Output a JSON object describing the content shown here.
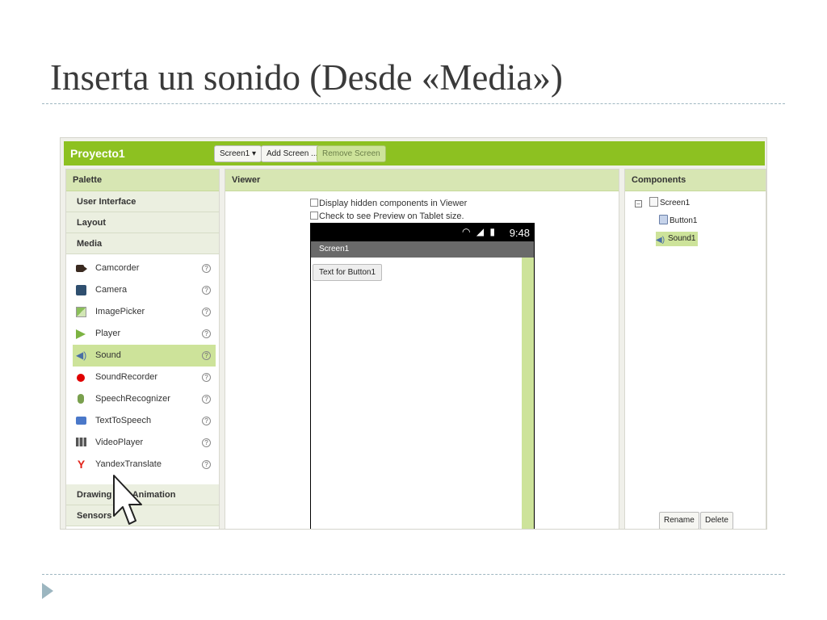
{
  "slide": {
    "title": "Inserta un sonido (Desde «Media»)"
  },
  "app": {
    "project_title": "Proyecto1",
    "toolbar": {
      "screen_selector": "Screen1 ▾",
      "add_screen": "Add Screen ...",
      "remove_screen": "Remove Screen"
    }
  },
  "palette": {
    "header": "Palette",
    "categories_top": [
      "User Interface",
      "Layout",
      "Media"
    ],
    "media_items": [
      {
        "label": "Camcorder",
        "icon": "camcorder-icon"
      },
      {
        "label": "Camera",
        "icon": "camera-icon"
      },
      {
        "label": "ImagePicker",
        "icon": "imagepicker-icon"
      },
      {
        "label": "Player",
        "icon": "player-icon"
      },
      {
        "label": "Sound",
        "icon": "sound-icon",
        "selected": true
      },
      {
        "label": "SoundRecorder",
        "icon": "soundrecorder-icon"
      },
      {
        "label": "SpeechRecognizer",
        "icon": "speechrecognizer-icon"
      },
      {
        "label": "TextToSpeech",
        "icon": "texttospeech-icon"
      },
      {
        "label": "VideoPlayer",
        "icon": "videoplayer-icon"
      },
      {
        "label": "YandexTranslate",
        "icon": "yandextranslate-icon"
      }
    ],
    "categories_bottom": [
      "Drawing and Animation",
      "Sensors"
    ],
    "help_glyph": "?"
  },
  "viewer": {
    "header": "Viewer",
    "display_hidden": "Display hidden components in Viewer",
    "tablet_preview": "Check to see Preview on Tablet size.",
    "status_time": "9:48",
    "screen_title": "Screen1",
    "button_text": "Text for Button1"
  },
  "components": {
    "header": "Components",
    "collapse_glyph": "⊟",
    "tree": {
      "root": "Screen1",
      "children": [
        "Button1",
        "Sound1"
      ]
    },
    "rename": "Rename",
    "delete": "Delete"
  },
  "colors": {
    "topbar_green": "#8dc121",
    "panel_header": "#d7e6b3",
    "selection": "#cde39a",
    "title_text": "#3a3a3a"
  }
}
